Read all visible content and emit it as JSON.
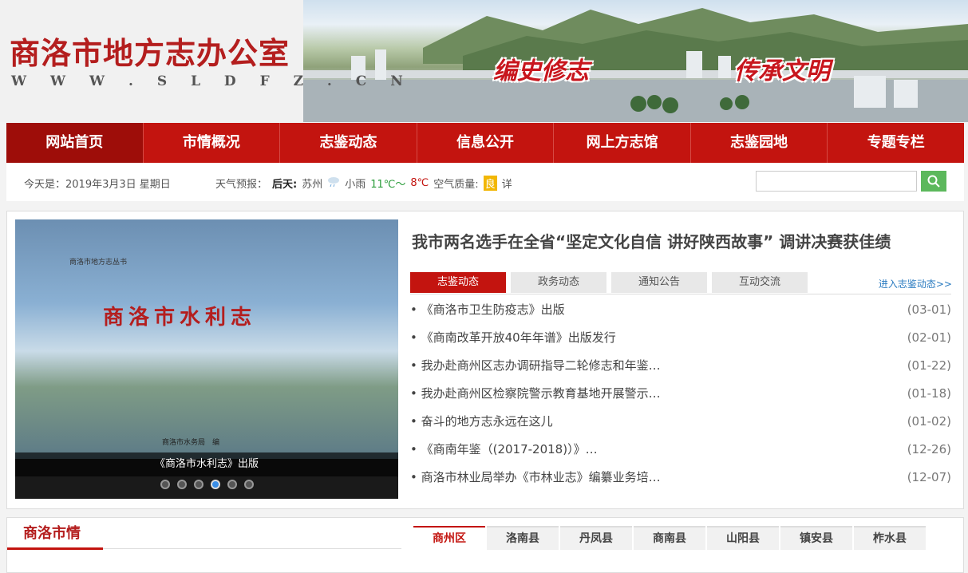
{
  "site": {
    "title": "商洛市地方志办公室",
    "url": "W W W . S L D F Z . C N",
    "slogan_left": "编史修志",
    "slogan_right": "传承文明"
  },
  "nav": [
    {
      "label": "网站首页",
      "active": true
    },
    {
      "label": "市情概况"
    },
    {
      "label": "志鉴动态"
    },
    {
      "label": "信息公开"
    },
    {
      "label": "网上方志馆"
    },
    {
      "label": "志鉴园地"
    },
    {
      "label": "专题专栏"
    }
  ],
  "infobar": {
    "date": "今天是：2019年3月3日 星期日",
    "weather_label": "天气预报：",
    "day": "后天:",
    "city": "苏州",
    "condition": "小雨",
    "temp_high": "11℃～",
    "temp_low": "8℃",
    "air_label": "空气质量:",
    "air_value": "良",
    "detail": "详"
  },
  "slider": {
    "series": "商洛市地方志丛书",
    "book_title": "商洛市水利志",
    "publisher": "商洛市水务局　编",
    "caption": "《商洛市水利志》出版",
    "dots": 6,
    "active_dot": 4
  },
  "headline": "我市两名选手在全省“坚定文化自信 讲好陕西故事” 调讲决赛获佳绩",
  "tabs": [
    {
      "label": "志鉴动态",
      "active": true
    },
    {
      "label": "政务动态"
    },
    {
      "label": "通知公告"
    },
    {
      "label": "互动交流"
    }
  ],
  "more_link": "进入志鉴动态>>",
  "news": [
    {
      "title": "• 《商洛市卫生防疫志》出版",
      "date": "(03-01)"
    },
    {
      "title": "• 《商南改革开放40年年谱》出版发行",
      "date": "(02-01)"
    },
    {
      "title": "• 我办赴商州区志办调研指导二轮修志和年鉴…",
      "date": "(01-22)"
    },
    {
      "title": "• 我办赴商州区检察院警示教育基地开展警示…",
      "date": "(01-18)"
    },
    {
      "title": "• 奋斗的地方志永远在这儿",
      "date": "(01-02)"
    },
    {
      "title": "• 《商南年鉴（(2017-2018)）》…",
      "date": "(12-26)"
    },
    {
      "title": "• 商洛市林业局举办《市林业志》编纂业务培…",
      "date": "(12-07)"
    }
  ],
  "section": {
    "title": "商洛市情",
    "counties": [
      {
        "label": "商州区",
        "active": true
      },
      {
        "label": "洛南县"
      },
      {
        "label": "丹凤县"
      },
      {
        "label": "商南县"
      },
      {
        "label": "山阳县"
      },
      {
        "label": "镇安县"
      },
      {
        "label": "柞水县"
      }
    ]
  },
  "colors": {
    "brand_red": "#c3140f",
    "search_green": "#5cb85c",
    "link_blue": "#2a7bc0"
  }
}
